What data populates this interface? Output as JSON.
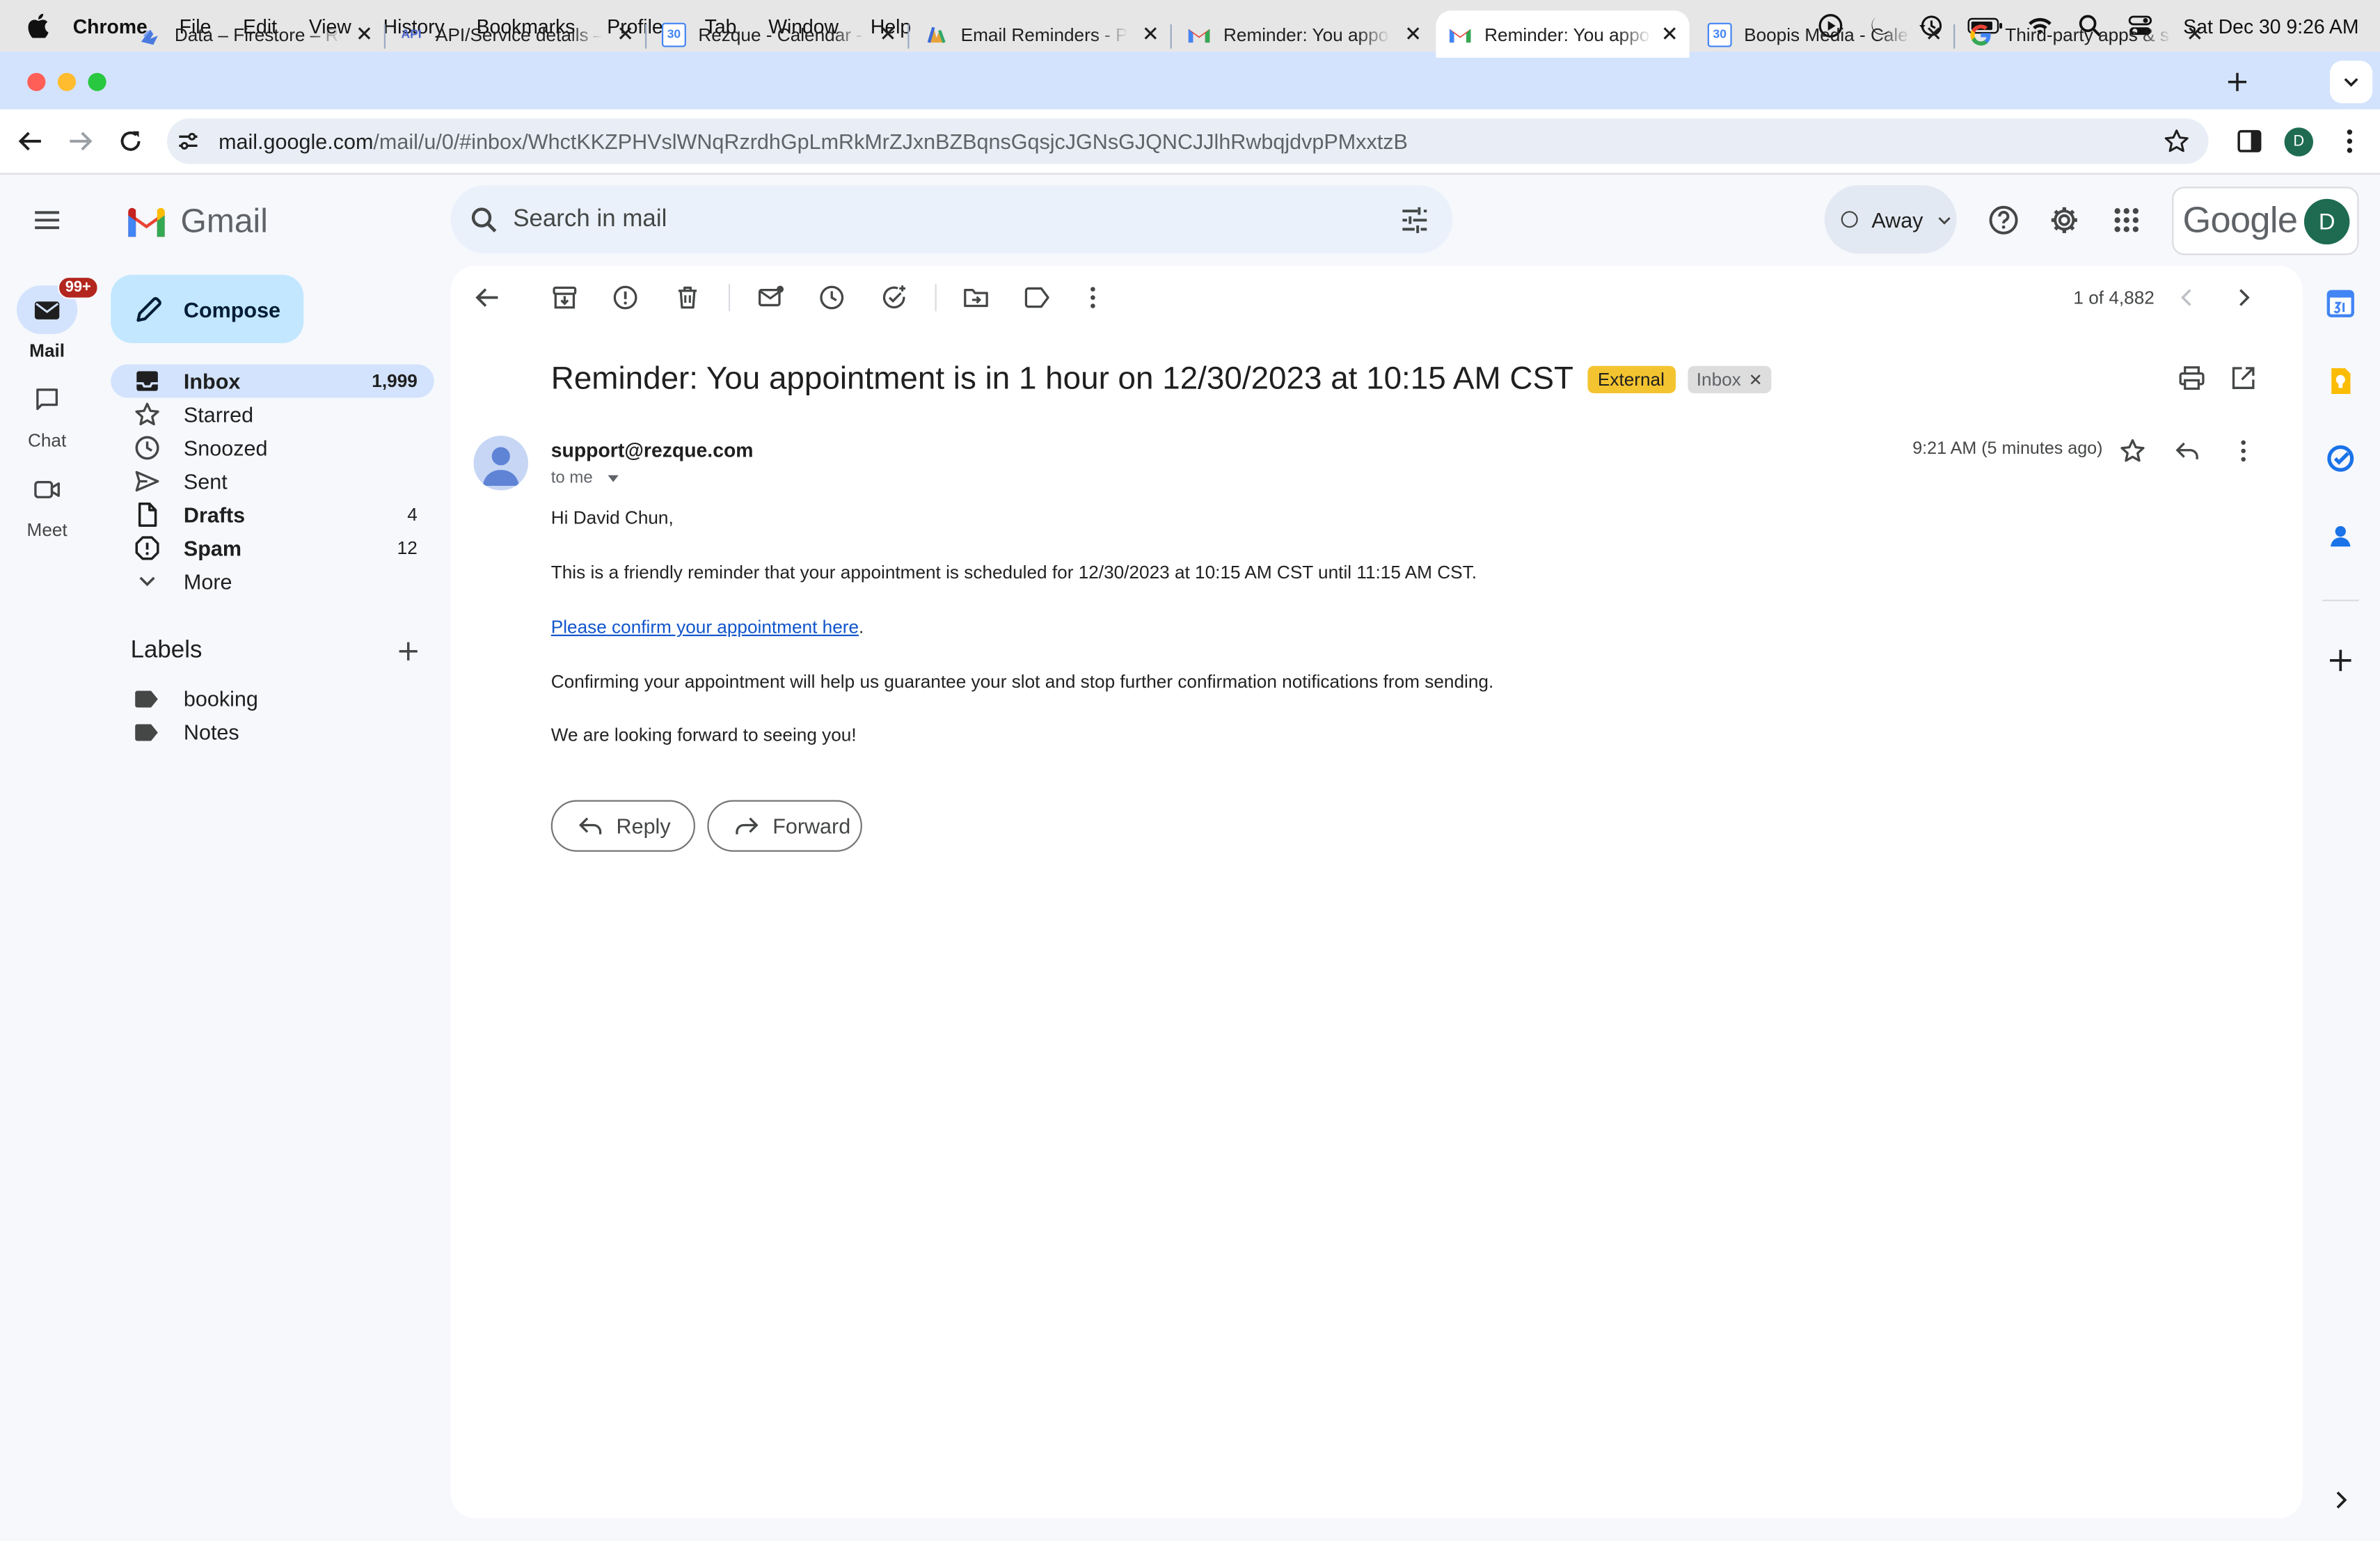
{
  "menubar": {
    "app": "Chrome",
    "menus": [
      "File",
      "Edit",
      "View",
      "History",
      "Bookmarks",
      "Profiles",
      "Tab",
      "Window",
      "Help"
    ],
    "clock": "Sat Dec 30  9:26 AM"
  },
  "tabs": [
    {
      "title": "Data – Firestore – Re",
      "icon": "firebase-icon"
    },
    {
      "title": "API/Service details –",
      "icon": "api-icon",
      "icon_text": "API"
    },
    {
      "title": "Rezque - Calendar -",
      "icon": "calendar-icon",
      "icon_text": "30"
    },
    {
      "title": "Email Reminders - Pi",
      "icon": "pipedream-icon"
    },
    {
      "title": "Reminder: You appoi",
      "icon": "gmail-icon"
    },
    {
      "title": "Reminder: You appoi",
      "icon": "gmail-icon",
      "active": true
    },
    {
      "title": "Boopis Media - Cale",
      "icon": "calendar-icon",
      "icon_text": "30"
    },
    {
      "title": "Third-party apps & s",
      "icon": "google-icon"
    }
  ],
  "address": {
    "host": "mail.google.com",
    "path": "/mail/u/0/#inbox/WhctKKZPHVslWNqRzrdhGpLmRkMrZJxnBZBqnsGqsjcJGNsGJQNCJJlhRwbqjdvpPMxxtzB",
    "profile_initial": "D"
  },
  "gmail": {
    "logo_text": "Gmail",
    "search_placeholder": "Search in mail",
    "status": "Away",
    "google_word": "Google",
    "avatar_initial": "D"
  },
  "rail": [
    {
      "label": "Mail",
      "badge": "99+"
    },
    {
      "label": "Chat"
    },
    {
      "label": "Meet"
    }
  ],
  "compose_label": "Compose",
  "folders": [
    {
      "label": "Inbox",
      "count": "1,999"
    },
    {
      "label": "Starred",
      "count": ""
    },
    {
      "label": "Snoozed",
      "count": ""
    },
    {
      "label": "Sent",
      "count": ""
    },
    {
      "label": "Drafts",
      "count": "4"
    },
    {
      "label": "Spam",
      "count": "12"
    },
    {
      "label": "More",
      "count": ""
    }
  ],
  "labels": {
    "heading": "Labels",
    "items": [
      "booking",
      "Notes"
    ]
  },
  "message": {
    "pager": "1 of 4,882",
    "subject": "Reminder: You appointment is in 1 hour on 12/30/2023 at 10:15 AM CST",
    "chip_external": "External",
    "chip_inbox": "Inbox",
    "sender": "support@rezque.com",
    "to": "to me",
    "time": "9:21 AM (5 minutes ago)",
    "greeting": "Hi David Chun,",
    "line1": "This is a friendly reminder that your appointment is scheduled for 12/30/2023 at 10:15 AM CST until 11:15 AM CST.",
    "link": "Please confirm your appointment here",
    "link_suffix": ".",
    "line3": "Confirming your appointment will help us guarantee your slot and stop further confirmation notifications from sending.",
    "line4": "We are looking forward to seeing you!",
    "reply_label": "Reply",
    "forward_label": "Forward"
  }
}
